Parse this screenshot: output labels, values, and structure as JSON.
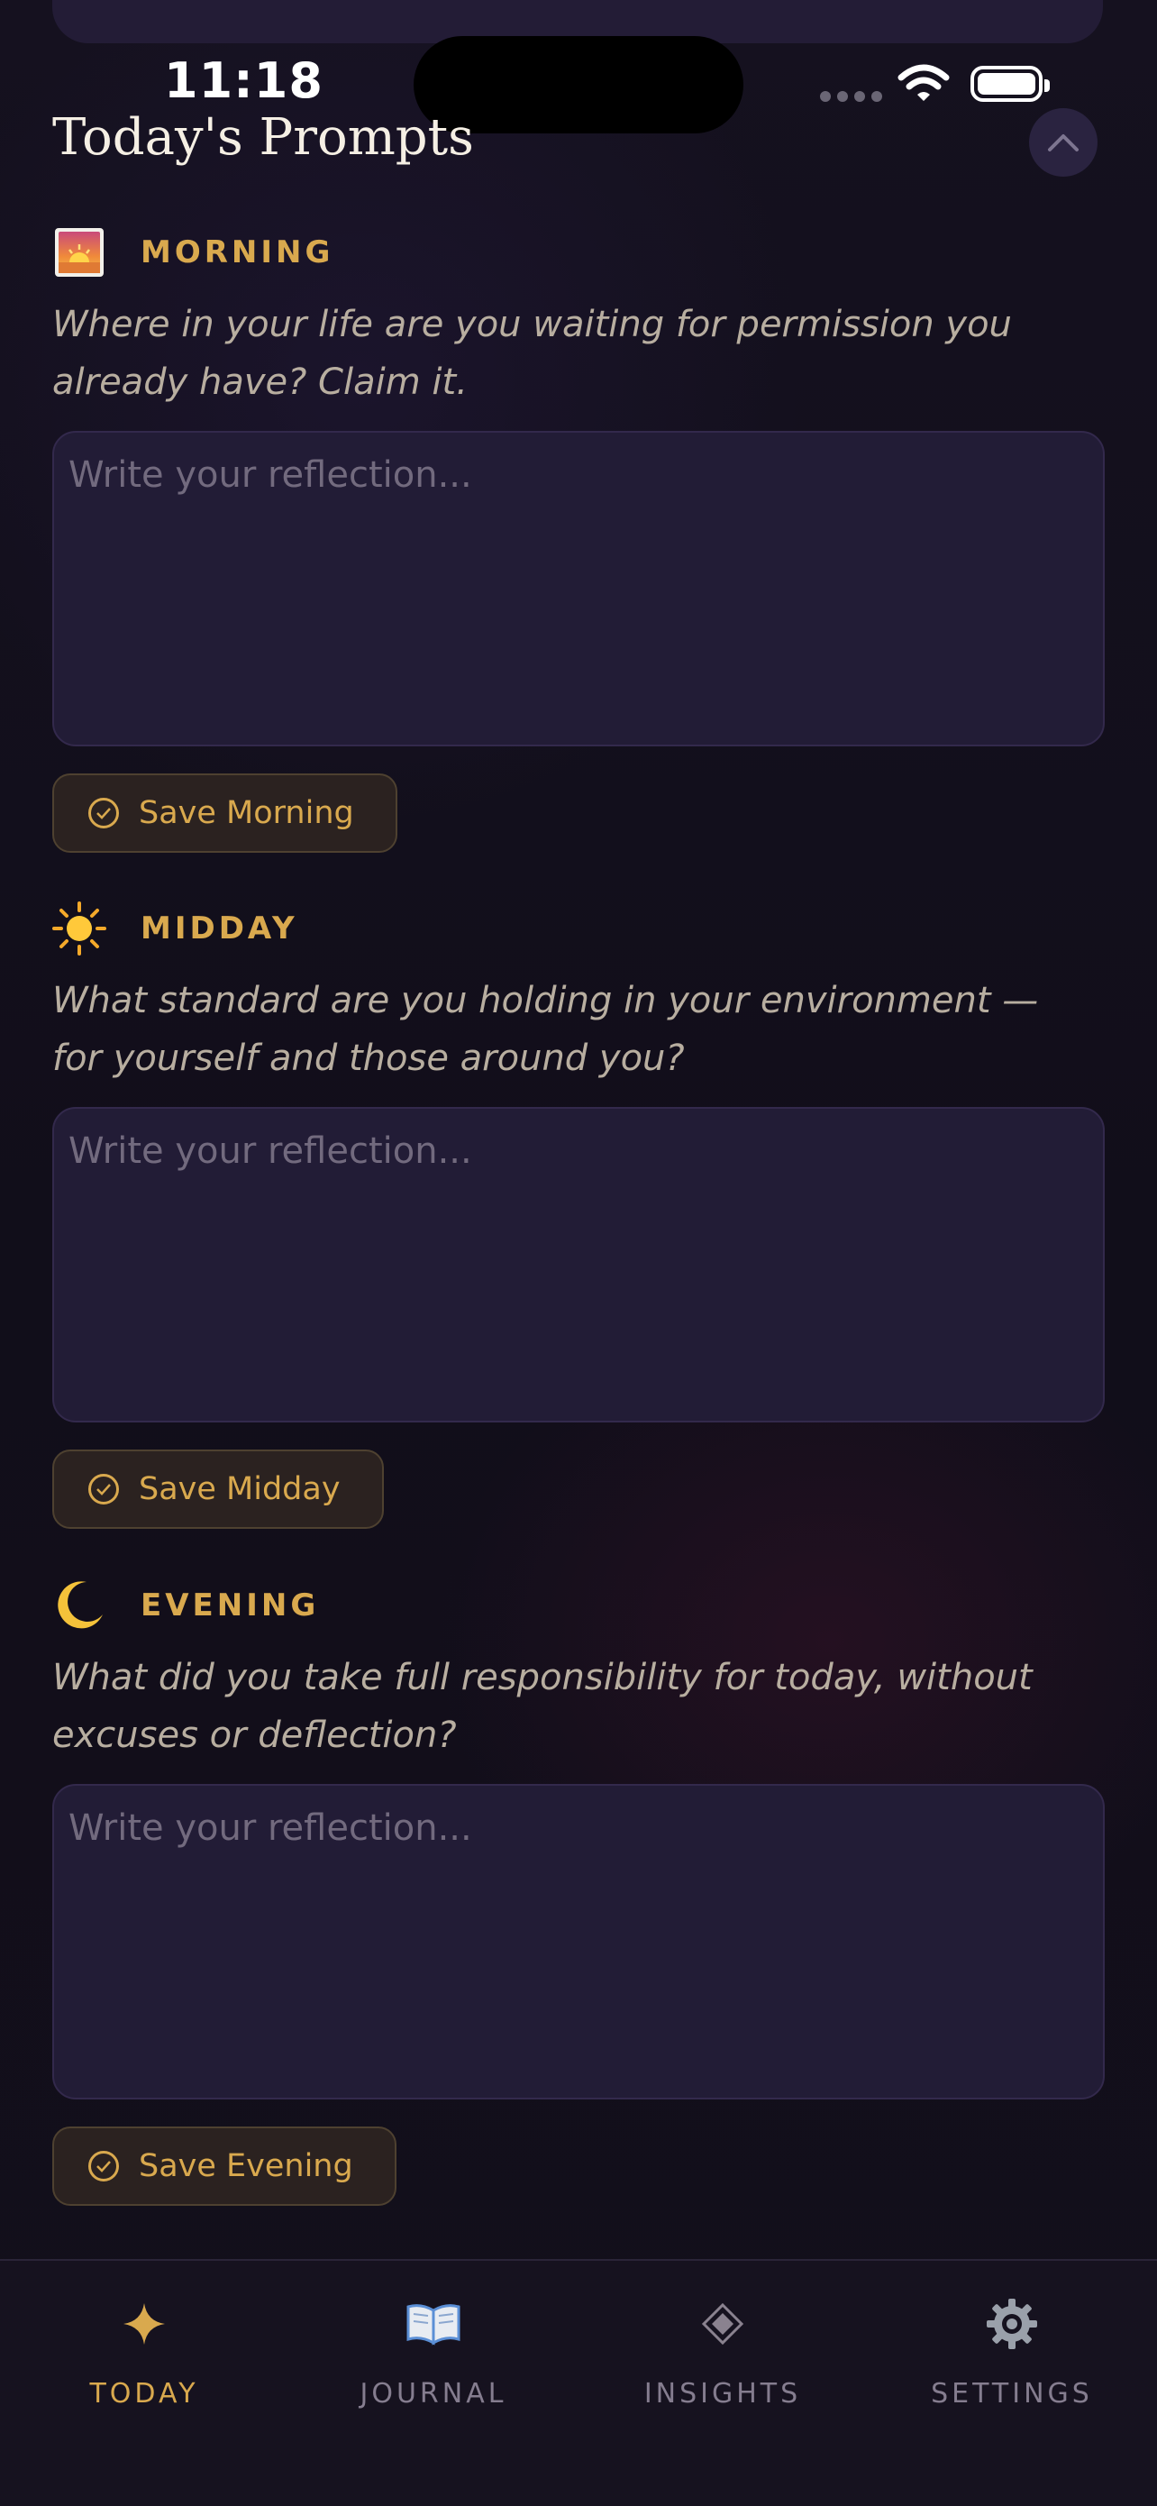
{
  "status_bar": {
    "time": "11:18"
  },
  "header": {
    "title": "Today's Prompts"
  },
  "sections": [
    {
      "label": "MORNING",
      "icon": "sunrise-icon",
      "prompt": "Where in your life are you waiting for permission you already have? Claim it.",
      "placeholder": "Write your reflection...",
      "save_label": "Save Morning"
    },
    {
      "label": "MIDDAY",
      "icon": "sun-icon",
      "prompt": "What standard are you holding in your environment — for yourself and those around you?",
      "placeholder": "Write your reflection...",
      "save_label": "Save Midday"
    },
    {
      "label": "EVENING",
      "icon": "moon-icon",
      "prompt": "What did you take full responsibility for today, without excuses or deflection?",
      "placeholder": "Write your reflection...",
      "save_label": "Save Evening"
    }
  ],
  "tabs": [
    {
      "label": "TODAY",
      "icon": "sparkle-icon",
      "active": true
    },
    {
      "label": "JOURNAL",
      "icon": "book-icon",
      "active": false
    },
    {
      "label": "INSIGHTS",
      "icon": "diamond-icon",
      "active": false
    },
    {
      "label": "SETTINGS",
      "icon": "gear-icon",
      "active": false
    }
  ],
  "colors": {
    "accent": "#d9a94e",
    "background": "#120f1c",
    "card": "#221c36"
  }
}
